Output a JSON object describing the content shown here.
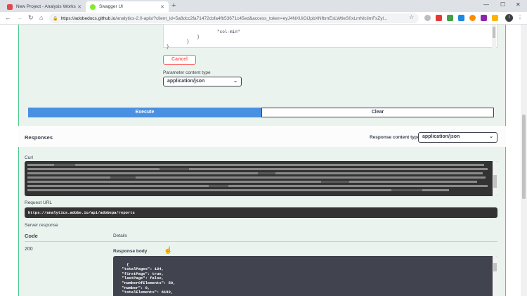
{
  "browser": {
    "tabs": [
      {
        "title": "New Project - Analysis Workspace",
        "favicon_color": "#e34850"
      },
      {
        "title": "Swagger UI",
        "favicon_color": "#85ea2d"
      }
    ],
    "url_host": "https://adobedocs.github.io",
    "url_path": "/analytics-2.0-apis/?client_id=5a8dcc2fa71472cbfa4fb53671c45ed&access_token=eyJ4NXUiOiJpbXNfbmEsLWtleS0xLmNlcilmFsZyl..."
  },
  "request": {
    "json_lines": "                \"col-min\"\n            }\n        }\n}",
    "cancel_label": "Cancel",
    "param_content_type_label": "Parameter content type",
    "param_content_type_value": "application/json",
    "execute_label": "Execute",
    "clear_label": "Clear"
  },
  "responses": {
    "title": "Responses",
    "content_type_label": "Response content type",
    "content_type_value": "application/json",
    "curl_label": "Curl",
    "request_url_label": "Request URL",
    "request_url": "https://analytics.adobe.io/api/adobepa/reports",
    "server_response_label": "Server response",
    "code_header": "Code",
    "details_header": "Details",
    "status_code": "200",
    "response_body_label": "Response body",
    "response_body": "{\n  \"totalPages\": 124,\n  \"firstPage\": true,\n  \"lastPage\": false,\n  \"numberOfElements\": 50,\n  \"number\": 0,\n  \"totalElements\": 6192,"
  },
  "colors": {
    "execute_blue": "#4990e2",
    "cancel_red": "#ff6060",
    "post_green_bg": "#ebf3ee",
    "post_green_border": "#49cc90",
    "code_bg": "#333333"
  }
}
